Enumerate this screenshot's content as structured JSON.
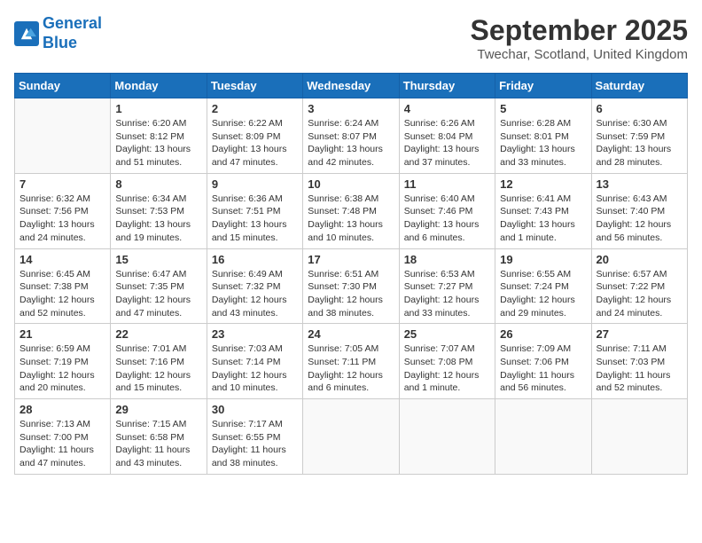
{
  "logo": {
    "line1": "General",
    "line2": "Blue"
  },
  "title": "September 2025",
  "location": "Twechar, Scotland, United Kingdom",
  "days_of_week": [
    "Sunday",
    "Monday",
    "Tuesday",
    "Wednesday",
    "Thursday",
    "Friday",
    "Saturday"
  ],
  "weeks": [
    [
      {
        "day": "",
        "info": ""
      },
      {
        "day": "1",
        "info": "Sunrise: 6:20 AM\nSunset: 8:12 PM\nDaylight: 13 hours\nand 51 minutes."
      },
      {
        "day": "2",
        "info": "Sunrise: 6:22 AM\nSunset: 8:09 PM\nDaylight: 13 hours\nand 47 minutes."
      },
      {
        "day": "3",
        "info": "Sunrise: 6:24 AM\nSunset: 8:07 PM\nDaylight: 13 hours\nand 42 minutes."
      },
      {
        "day": "4",
        "info": "Sunrise: 6:26 AM\nSunset: 8:04 PM\nDaylight: 13 hours\nand 37 minutes."
      },
      {
        "day": "5",
        "info": "Sunrise: 6:28 AM\nSunset: 8:01 PM\nDaylight: 13 hours\nand 33 minutes."
      },
      {
        "day": "6",
        "info": "Sunrise: 6:30 AM\nSunset: 7:59 PM\nDaylight: 13 hours\nand 28 minutes."
      }
    ],
    [
      {
        "day": "7",
        "info": "Sunrise: 6:32 AM\nSunset: 7:56 PM\nDaylight: 13 hours\nand 24 minutes."
      },
      {
        "day": "8",
        "info": "Sunrise: 6:34 AM\nSunset: 7:53 PM\nDaylight: 13 hours\nand 19 minutes."
      },
      {
        "day": "9",
        "info": "Sunrise: 6:36 AM\nSunset: 7:51 PM\nDaylight: 13 hours\nand 15 minutes."
      },
      {
        "day": "10",
        "info": "Sunrise: 6:38 AM\nSunset: 7:48 PM\nDaylight: 13 hours\nand 10 minutes."
      },
      {
        "day": "11",
        "info": "Sunrise: 6:40 AM\nSunset: 7:46 PM\nDaylight: 13 hours\nand 6 minutes."
      },
      {
        "day": "12",
        "info": "Sunrise: 6:41 AM\nSunset: 7:43 PM\nDaylight: 13 hours\nand 1 minute."
      },
      {
        "day": "13",
        "info": "Sunrise: 6:43 AM\nSunset: 7:40 PM\nDaylight: 12 hours\nand 56 minutes."
      }
    ],
    [
      {
        "day": "14",
        "info": "Sunrise: 6:45 AM\nSunset: 7:38 PM\nDaylight: 12 hours\nand 52 minutes."
      },
      {
        "day": "15",
        "info": "Sunrise: 6:47 AM\nSunset: 7:35 PM\nDaylight: 12 hours\nand 47 minutes."
      },
      {
        "day": "16",
        "info": "Sunrise: 6:49 AM\nSunset: 7:32 PM\nDaylight: 12 hours\nand 43 minutes."
      },
      {
        "day": "17",
        "info": "Sunrise: 6:51 AM\nSunset: 7:30 PM\nDaylight: 12 hours\nand 38 minutes."
      },
      {
        "day": "18",
        "info": "Sunrise: 6:53 AM\nSunset: 7:27 PM\nDaylight: 12 hours\nand 33 minutes."
      },
      {
        "day": "19",
        "info": "Sunrise: 6:55 AM\nSunset: 7:24 PM\nDaylight: 12 hours\nand 29 minutes."
      },
      {
        "day": "20",
        "info": "Sunrise: 6:57 AM\nSunset: 7:22 PM\nDaylight: 12 hours\nand 24 minutes."
      }
    ],
    [
      {
        "day": "21",
        "info": "Sunrise: 6:59 AM\nSunset: 7:19 PM\nDaylight: 12 hours\nand 20 minutes."
      },
      {
        "day": "22",
        "info": "Sunrise: 7:01 AM\nSunset: 7:16 PM\nDaylight: 12 hours\nand 15 minutes."
      },
      {
        "day": "23",
        "info": "Sunrise: 7:03 AM\nSunset: 7:14 PM\nDaylight: 12 hours\nand 10 minutes."
      },
      {
        "day": "24",
        "info": "Sunrise: 7:05 AM\nSunset: 7:11 PM\nDaylight: 12 hours\nand 6 minutes."
      },
      {
        "day": "25",
        "info": "Sunrise: 7:07 AM\nSunset: 7:08 PM\nDaylight: 12 hours\nand 1 minute."
      },
      {
        "day": "26",
        "info": "Sunrise: 7:09 AM\nSunset: 7:06 PM\nDaylight: 11 hours\nand 56 minutes."
      },
      {
        "day": "27",
        "info": "Sunrise: 7:11 AM\nSunset: 7:03 PM\nDaylight: 11 hours\nand 52 minutes."
      }
    ],
    [
      {
        "day": "28",
        "info": "Sunrise: 7:13 AM\nSunset: 7:00 PM\nDaylight: 11 hours\nand 47 minutes."
      },
      {
        "day": "29",
        "info": "Sunrise: 7:15 AM\nSunset: 6:58 PM\nDaylight: 11 hours\nand 43 minutes."
      },
      {
        "day": "30",
        "info": "Sunrise: 7:17 AM\nSunset: 6:55 PM\nDaylight: 11 hours\nand 38 minutes."
      },
      {
        "day": "",
        "info": ""
      },
      {
        "day": "",
        "info": ""
      },
      {
        "day": "",
        "info": ""
      },
      {
        "day": "",
        "info": ""
      }
    ]
  ]
}
